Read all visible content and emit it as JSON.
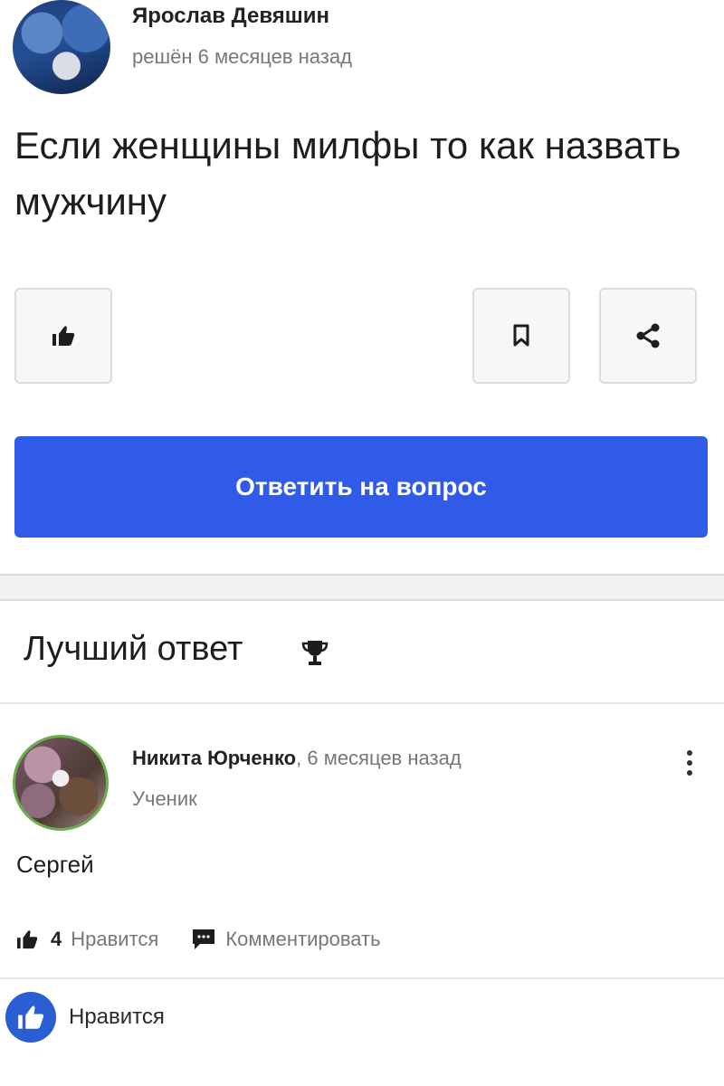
{
  "question": {
    "author_name": "Ярослав Девяшин",
    "meta": "решён 6 месяцев назад",
    "text": "Если женщины милфы то как назвать мужчину"
  },
  "actions": {
    "answer_button_label": "Ответить на вопрос"
  },
  "best_answer": {
    "section_title": "Лучший ответ",
    "author_name": "Никита Юрченко",
    "separator": ", ",
    "time": "6 месяцев назад",
    "role": "Ученик",
    "text": "Сергей",
    "like_count": "4",
    "like_label": "Нравится",
    "comment_label": "Комментировать"
  },
  "footer": {
    "like_label": "Нравится"
  },
  "colors": {
    "primary_button": "#2f5be8",
    "fb_like_blue": "#2a5fd4"
  },
  "icons": [
    "thumbs-up-icon",
    "bookmark-icon",
    "share-icon",
    "trophy-icon",
    "more-vertical-icon",
    "comment-icon"
  ]
}
